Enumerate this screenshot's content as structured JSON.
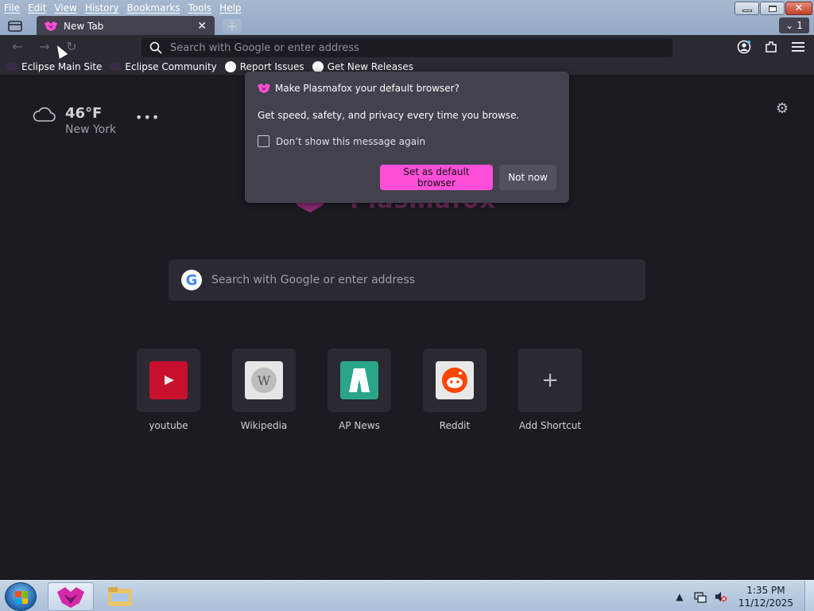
{
  "menu": [
    "File",
    "Edit",
    "View",
    "History",
    "Bookmarks",
    "Tools",
    "Help"
  ],
  "tab": {
    "title": "New Tab",
    "count": "1"
  },
  "urlbar": {
    "placeholder": "Search with Google or enter address"
  },
  "bookmarks": [
    {
      "label": "Eclipse Main Site",
      "icon": "eclipse-icon"
    },
    {
      "label": "Eclipse Community",
      "icon": "eclipse-icon"
    },
    {
      "label": "Report Issues",
      "icon": "github-icon"
    },
    {
      "label": "Get New Releases",
      "icon": "github-icon"
    }
  ],
  "weather": {
    "temp": "46°F",
    "city": "New York"
  },
  "logo_text": "Plasmafox",
  "search": {
    "placeholder": "Search with Google or enter address"
  },
  "shortcuts": [
    {
      "label": "youtube"
    },
    {
      "label": "Wikipedia"
    },
    {
      "label": "AP News"
    },
    {
      "label": "Reddit"
    },
    {
      "label": "Add Shortcut"
    }
  ],
  "popup": {
    "title": "Make Plasmafox your default browser?",
    "message": "Get speed, safety, and privacy every time you browse.",
    "checkbox_label": "Don’t show this message again",
    "primary": "Set as default browser",
    "secondary": "Not now"
  },
  "taskbar": {
    "time": "1:35 PM",
    "date": "11/12/2025"
  },
  "colors": {
    "accent": "#ff4fd8",
    "background": "#1c1b22",
    "toolbar": "#2b2a33"
  }
}
